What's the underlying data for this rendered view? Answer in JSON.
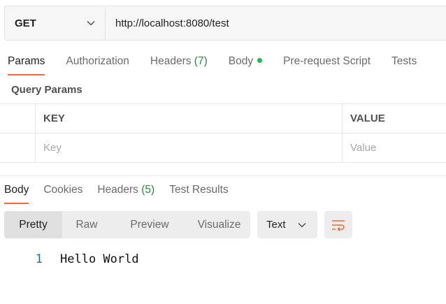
{
  "request": {
    "method": "GET",
    "url": "http://localhost:8080/test"
  },
  "request_tabs": [
    {
      "label": "Params",
      "active": true
    },
    {
      "label": "Authorization"
    },
    {
      "label": "Headers",
      "count": "(7)"
    },
    {
      "label": "Body",
      "indicator": "green-dot"
    },
    {
      "label": "Pre-request Script"
    },
    {
      "label": "Tests"
    }
  ],
  "query_params": {
    "title": "Query Params",
    "columns": [
      "KEY",
      "VALUE"
    ],
    "placeholders": {
      "key": "Key",
      "value": "Value"
    }
  },
  "response_tabs": [
    {
      "label": "Body",
      "active": true
    },
    {
      "label": "Cookies"
    },
    {
      "label": "Headers",
      "count": "(5)"
    },
    {
      "label": "Test Results"
    }
  ],
  "response_toolbar": {
    "views": [
      "Pretty",
      "Raw",
      "Preview",
      "Visualize"
    ],
    "selected_view": "Pretty",
    "format": "Text",
    "wrap_icon": "wrap-lines-icon"
  },
  "response_body": {
    "lines": [
      {
        "number": "1",
        "text": "Hello World"
      }
    ]
  },
  "colors": {
    "accent": "#f26b3a",
    "dot": "#26b55a",
    "count": "#2a8a3a",
    "line_number": "#1f6f8b"
  }
}
